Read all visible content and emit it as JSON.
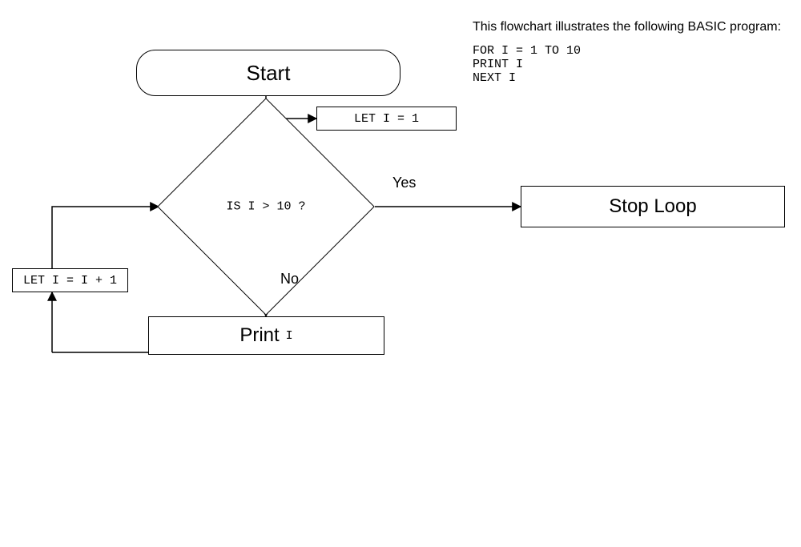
{
  "caption": "This flowchart illustrates the following BASIC program:",
  "code": "FOR I = 1 TO 10\nPRINT I\nNEXT I",
  "nodes": {
    "start": "Start",
    "init": "LET I = 1",
    "cond": "IS I > 10 ?",
    "inc": "LET I = I + 1",
    "print_word": "Print",
    "print_var": "I",
    "stop": "Stop Loop"
  },
  "labels": {
    "yes": "Yes",
    "no": "No"
  },
  "chart_data": {
    "type": "flowchart",
    "nodes": [
      {
        "id": "start",
        "shape": "terminator",
        "text": "Start"
      },
      {
        "id": "init",
        "shape": "process",
        "text": "LET I = 1"
      },
      {
        "id": "cond",
        "shape": "decision",
        "text": "IS I > 10 ?"
      },
      {
        "id": "print",
        "shape": "process",
        "text": "Print I"
      },
      {
        "id": "inc",
        "shape": "process",
        "text": "LET I = I + 1"
      },
      {
        "id": "stop",
        "shape": "terminator",
        "text": "Stop Loop"
      }
    ],
    "edges": [
      {
        "from": "start",
        "to": "init"
      },
      {
        "from": "init",
        "to": "cond"
      },
      {
        "from": "cond",
        "to": "stop",
        "label": "Yes"
      },
      {
        "from": "cond",
        "to": "print",
        "label": "No"
      },
      {
        "from": "print",
        "to": "inc"
      },
      {
        "from": "inc",
        "to": "cond"
      }
    ]
  }
}
